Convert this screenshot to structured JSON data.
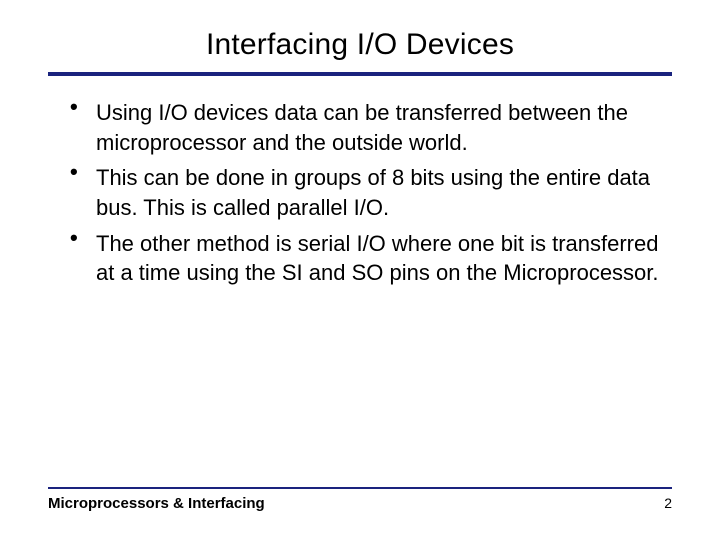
{
  "title": "Interfacing I/O Devices",
  "bullets": [
    "Using I/O devices data can be transferred between the microprocessor and the outside world.",
    "This can be done in groups of 8 bits using the entire data bus. This is called parallel I/O.",
    "The other method is serial I/O where one bit is transferred at a time using the SI and SO pins on the Microprocessor."
  ],
  "footer": {
    "text": "Microprocessors & Interfacing",
    "page": "2"
  }
}
